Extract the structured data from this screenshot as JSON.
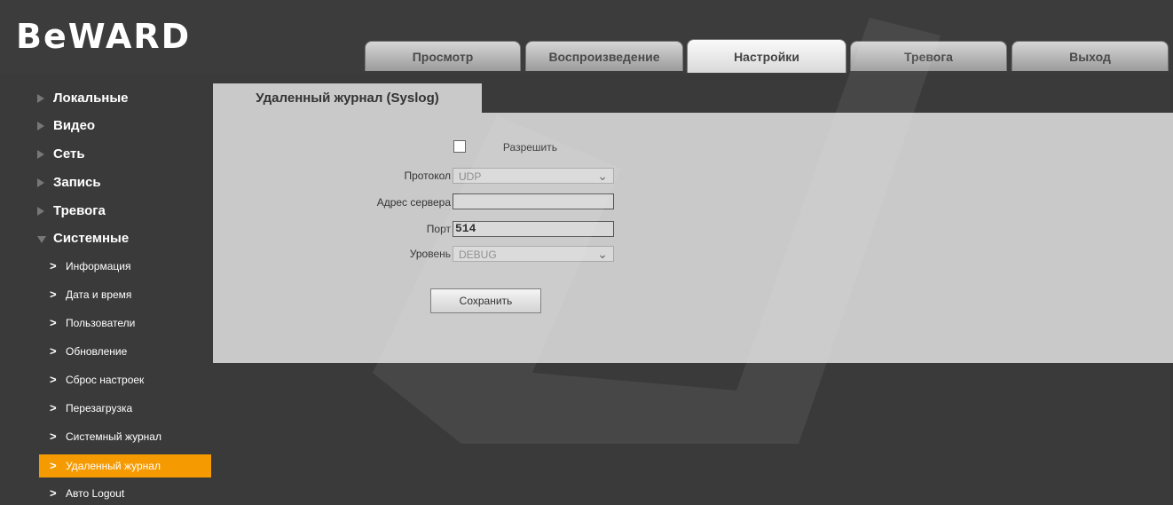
{
  "logo": {
    "text": "BeWARD"
  },
  "nav": {
    "tabs": [
      {
        "label": "Просмотр"
      },
      {
        "label": "Воспроизведение"
      },
      {
        "label": "Настройки"
      },
      {
        "label": "Тревога"
      },
      {
        "label": "Выход"
      }
    ],
    "active_tab": "Настройки"
  },
  "sidebar": {
    "groups": [
      {
        "label": "Локальные"
      },
      {
        "label": "Видео"
      },
      {
        "label": "Сеть"
      },
      {
        "label": "Запись"
      },
      {
        "label": "Тревога"
      },
      {
        "label": "Системные"
      }
    ],
    "sub_items": [
      {
        "label": "Информация"
      },
      {
        "label": "Дата и время"
      },
      {
        "label": "Пользователи"
      },
      {
        "label": "Обновление"
      },
      {
        "label": "Сброс настроек"
      },
      {
        "label": "Перезагрузка"
      },
      {
        "label": "Системный журнал"
      },
      {
        "label": "Удаленный журнал"
      },
      {
        "label": "Авто Logout"
      }
    ],
    "active_sub_item": "Удаленный журнал"
  },
  "main": {
    "title": "Удаленный журнал (Syslog)",
    "form": {
      "enable_label": "Разрешить",
      "enable_checked": false,
      "protocol_label": "Протокол",
      "protocol_value": "UDP",
      "server_label": "Адрес сервера",
      "server_value": "",
      "port_label": "Порт",
      "port_value": "514",
      "level_label": "Уровень",
      "level_value": "DEBUG"
    },
    "save_label": "Сохранить"
  },
  "colors": {
    "accent": "#f59a00",
    "panel": "#c9c9c9",
    "background": "#3a3a3a"
  }
}
